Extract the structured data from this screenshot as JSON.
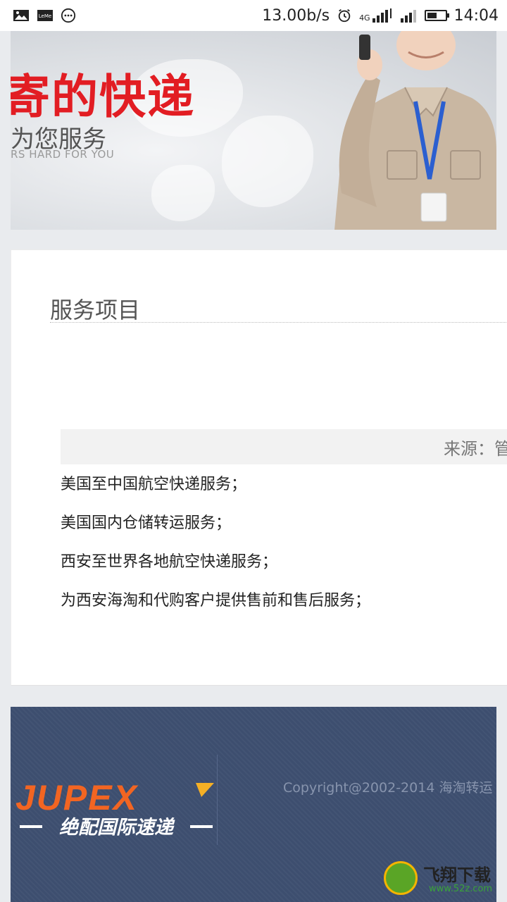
{
  "status_bar": {
    "network_speed": "13.00b/s",
    "network_type": "4G",
    "time": "14:04",
    "battery_level": 0.55,
    "left_icons": [
      "gallery-icon",
      "leme-app-icon",
      "more-notifications-icon"
    ]
  },
  "banner": {
    "title": "寄的快递",
    "subtitle": "为您服务",
    "english": "RS HARD FOR YOU"
  },
  "section": {
    "title": "服务项目",
    "source_label": "来源：管"
  },
  "services": [
    "美国至中国航空快递服务；",
    "美国国内仓储转运服务；",
    "西安至世界各地航空快递服务；",
    "为西安海淘和代购客户提供售前和售后服务；"
  ],
  "footer": {
    "logo_text": "JUPEX",
    "logo_tagline": "绝配国际速递",
    "copyright": "Copyright@2002-2014 海淘转运"
  },
  "watermark": {
    "name": "飞翔下载",
    "url": "www.52z.com"
  },
  "colors": {
    "accent_red": "#e21d23",
    "footer_bg": "#3d4e6f",
    "logo_orange": "#f26522"
  }
}
